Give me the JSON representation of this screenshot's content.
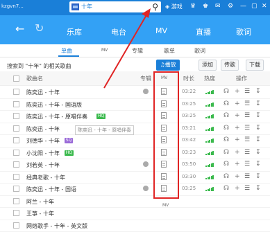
{
  "app": {
    "title": "kzgvn7..."
  },
  "search": {
    "value": "十年",
    "icon": "search-icon"
  },
  "top_icons": {
    "game_label": "游戏",
    "game_icon": "gamepad-icon"
  },
  "nav": {
    "tabs": [
      "乐库",
      "电台",
      "MV",
      "直播",
      "歌词"
    ]
  },
  "subtabs": [
    "单曲",
    "MV",
    "专辑",
    "歌单",
    "歌词"
  ],
  "results": {
    "hint_prefix": "搜索到",
    "keyword": "\"十年\"",
    "hint_suffix": "的相关歌曲"
  },
  "actions": {
    "play_all": "播放",
    "add": "添加",
    "upload": "传歌",
    "download": "下载"
  },
  "table": {
    "headers": {
      "song": "歌曲名",
      "album": "专辑",
      "mv": "MV",
      "duration": "时长",
      "heat": "热度",
      "operation": "操作"
    },
    "rows": [
      {
        "title": "陈奕迅 - 十年",
        "badge": "",
        "album_icon": true,
        "duration": "03:22"
      },
      {
        "title": "陈奕迅 - 十年 - 国语版",
        "badge": "",
        "album_icon": false,
        "duration": "03:25"
      },
      {
        "title": "陈奕迅 - 十年 - 原唱伴奏",
        "badge": "HQ",
        "album_icon": false,
        "duration": "03:25"
      },
      {
        "title": "陈奕迅 - 十年",
        "badge": "",
        "album_icon": false,
        "duration": "03:21"
      },
      {
        "title": "刘德华 - 十年",
        "badge": "SQ",
        "album_icon": false,
        "duration": "03:42"
      },
      {
        "title": "小沈阳 - 十年",
        "badge": "HQ",
        "album_icon": false,
        "duration": "03:23"
      },
      {
        "title": "刘若英 - 十年",
        "badge": "",
        "album_icon": true,
        "duration": "03:50"
      },
      {
        "title": "经典老歌 - 十年",
        "badge": "",
        "album_icon": false,
        "duration": "03:30"
      },
      {
        "title": "陈奕迅 - 十年 - 国语",
        "badge": "",
        "album_icon": true,
        "duration": "03:25"
      },
      {
        "title": "阿兰 - 十年",
        "badge": "",
        "album_icon": false,
        "duration": ""
      },
      {
        "title": "王箏 - 十年",
        "badge": "",
        "album_icon": false,
        "duration": ""
      },
      {
        "title": "网络歌手 - 十年 - 英文版",
        "badge": "",
        "album_icon": false,
        "duration": ""
      }
    ]
  },
  "tooltip": "陈奕迅 - 十年 - 原唱伴奏",
  "colors": {
    "brand": "#1a7fd8",
    "nav": "#33a1f5",
    "annotation": "#e02424",
    "hq_badge": "#3cba4e",
    "sq_badge": "#9a6ad8"
  }
}
